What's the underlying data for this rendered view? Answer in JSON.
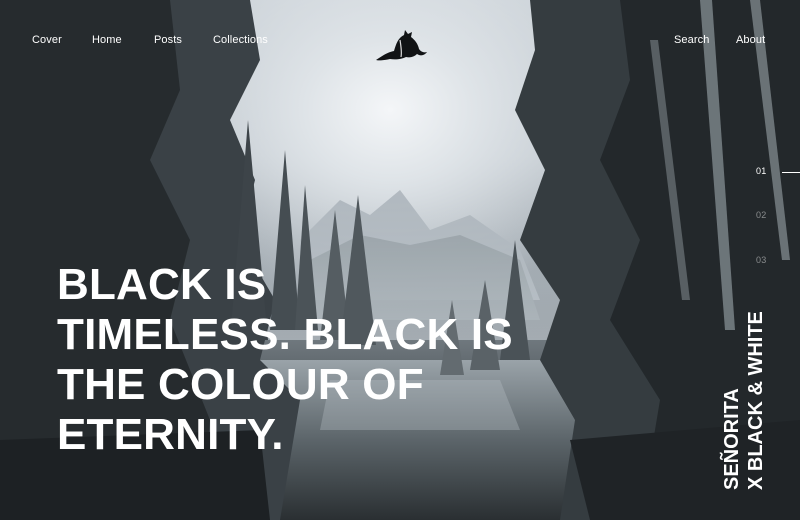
{
  "nav": {
    "left": [
      "Cover",
      "Home",
      "Posts",
      "Collections"
    ],
    "right": [
      "Search",
      "About"
    ]
  },
  "logo": {
    "icon": "cat-silhouette-icon"
  },
  "slides": {
    "items": [
      "01",
      "02",
      "03"
    ],
    "active": "01"
  },
  "headline": {
    "lines": [
      "BLACK IS",
      "TIMELESS. BLACK IS",
      "THE COLOUR OF",
      "ETERNITY."
    ]
  },
  "side_caption": {
    "lines": [
      "SEÑORITA",
      "X BLACK & WHITE"
    ]
  },
  "colors": {
    "text": "#ffffff",
    "scene_dark": "#2f3538",
    "sky": "#dfe4e8"
  }
}
